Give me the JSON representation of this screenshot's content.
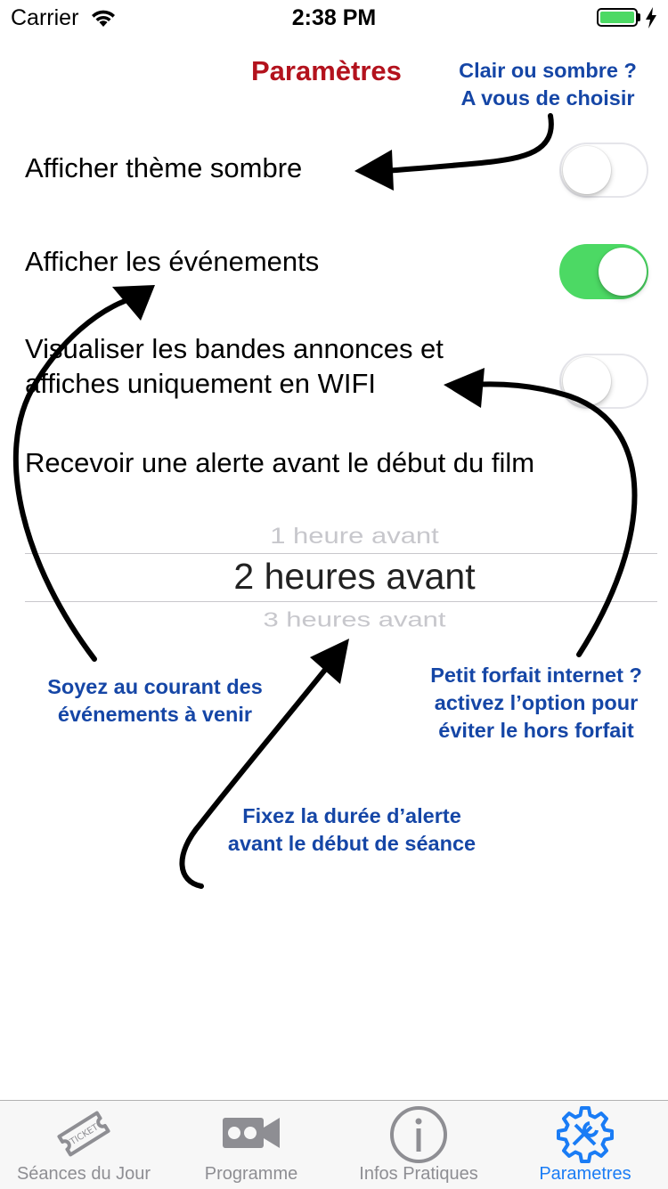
{
  "status": {
    "carrier": "Carrier",
    "time": "2:38 PM",
    "battery_level": 1.0,
    "battery_color": "#4cd964"
  },
  "header": {
    "title": "Paramètres"
  },
  "settings": [
    {
      "label_lines": [
        "Afficher thème sombre"
      ],
      "toggle_on": false
    },
    {
      "label_lines": [
        "Afficher les événements"
      ],
      "toggle_on": true
    },
    {
      "label_lines": [
        "Visualiser les bandes annonces et",
        "affiches uniquement en WIFI"
      ],
      "toggle_on": false
    }
  ],
  "alert": {
    "label": "Recevoir une alerte avant le début du film",
    "picker": {
      "options_visible": [
        "1 heure avant",
        "2 heures avant",
        "3 heures avant"
      ],
      "selected": "2 heures avant"
    }
  },
  "annotations": {
    "theme": [
      "Clair ou sombre ?",
      "A vous de choisir"
    ],
    "events": [
      "Soyez au courant des",
      "événements à venir"
    ],
    "wifi": [
      "Petit forfait internet ?",
      "activez l’option pour",
      "éviter le hors forfait"
    ],
    "alert": [
      "Fixez la durée d’alerte",
      "avant le début de séance"
    ]
  },
  "tabs": [
    {
      "label": "Séances du Jour",
      "icon": "ticket-icon",
      "active": false
    },
    {
      "label": "Programme",
      "icon": "video-camera-icon",
      "active": false
    },
    {
      "label": "Infos Pratiques",
      "icon": "info-icon",
      "active": false
    },
    {
      "label": "Parametres",
      "icon": "settings-tools-icon",
      "active": true
    }
  ],
  "colors": {
    "title": "#b3121d",
    "annotation": "#1546a6",
    "toggle_on": "#4cd964",
    "tab_active": "#1a7cf5",
    "tab_inactive": "#8e8e93"
  }
}
